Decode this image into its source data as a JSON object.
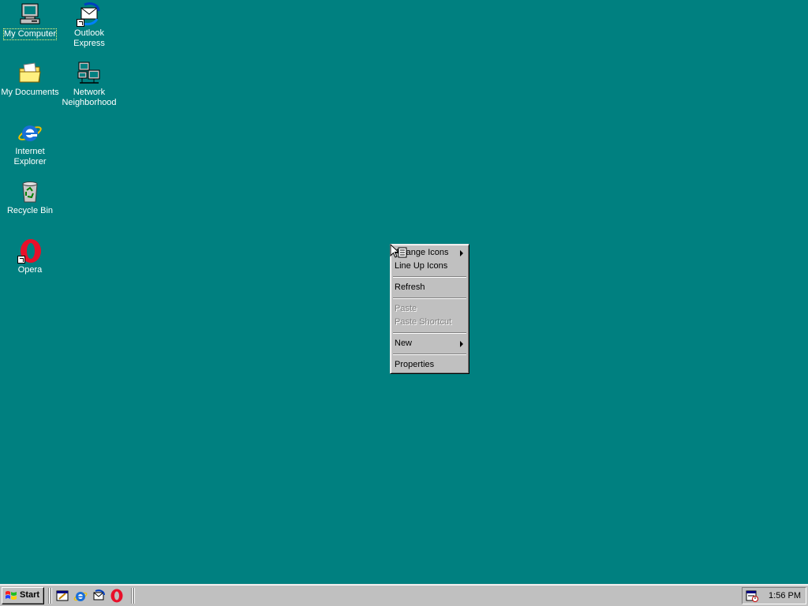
{
  "desktop": {
    "background": "#008080",
    "icons": [
      {
        "label": "My Computer",
        "icon": "my-computer-icon",
        "selected": true
      },
      {
        "label": "Outlook Express",
        "icon": "outlook-express-icon",
        "shortcut": true
      },
      {
        "label": "My Documents",
        "icon": "my-documents-icon"
      },
      {
        "label": "Network Neighborhood",
        "icon": "network-neighborhood-icon"
      },
      {
        "label": "Internet Explorer",
        "icon": "internet-explorer-icon"
      },
      {
        "label": "Recycle Bin",
        "icon": "recycle-bin-icon"
      },
      {
        "label": "Opera",
        "icon": "opera-icon",
        "shortcut": true
      }
    ]
  },
  "context_menu": {
    "items": [
      {
        "label": "Arrange Icons",
        "submenu": true,
        "enabled": true
      },
      {
        "label": "Line Up Icons",
        "enabled": true
      },
      {
        "label": "Refresh",
        "enabled": true
      },
      {
        "label": "Paste",
        "enabled": false
      },
      {
        "label": "Paste Shortcut",
        "enabled": false
      },
      {
        "label": "New",
        "submenu": true,
        "enabled": true
      },
      {
        "label": "Properties",
        "enabled": true
      }
    ]
  },
  "taskbar": {
    "start_label": "Start",
    "quick_launch": [
      "show-desktop-icon",
      "internet-explorer-icon",
      "outlook-express-icon",
      "opera-icon"
    ],
    "tray_icon": "scheduler-icon",
    "clock": "1:56 PM"
  }
}
